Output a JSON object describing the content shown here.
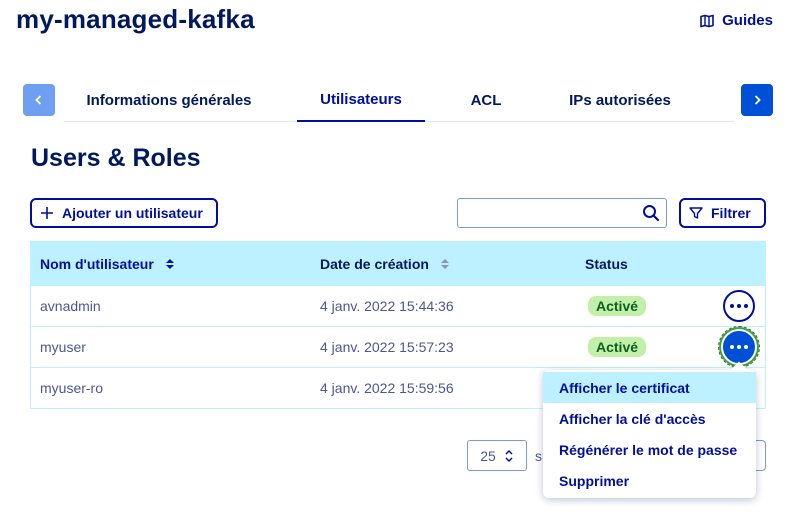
{
  "header": {
    "title": "my-managed-kafka",
    "guides_label": "Guides"
  },
  "tabs": [
    {
      "label": "Informations générales",
      "active": false
    },
    {
      "label": "Utilisateurs",
      "active": true
    },
    {
      "label": "ACL",
      "active": false
    },
    {
      "label": "IPs autorisées",
      "active": false
    }
  ],
  "section": {
    "title": "Users & Roles",
    "add_user_label": "Ajouter un utilisateur",
    "filter_label": "Filtrer",
    "search_value": ""
  },
  "table": {
    "headers": {
      "name": "Nom d'utilisateur",
      "date": "Date de création",
      "status": "Status"
    },
    "rows": [
      {
        "name": "avnadmin",
        "date": "4 janv. 2022 15:44:36",
        "status": "Activé"
      },
      {
        "name": "myuser",
        "date": "4 janv. 2022 15:57:23",
        "status": "Activé"
      },
      {
        "name": "myuser-ro",
        "date": "4 janv. 2022 15:59:56",
        "status": ""
      }
    ]
  },
  "pagination": {
    "page_size": "25",
    "suffix": "su"
  },
  "menu": {
    "items": [
      {
        "label": "Afficher le certificat",
        "active": true
      },
      {
        "label": "Afficher la clé d'accès",
        "active": false
      },
      {
        "label": "Régénérer le mot de passe",
        "active": false
      },
      {
        "label": "Supprimer",
        "active": false
      }
    ]
  },
  "colors": {
    "primary": "#000e9c",
    "title": "#00185e",
    "table_header_bg": "#bef1ff",
    "badge_bg": "#c2f0a8",
    "badge_text": "#0a5f22",
    "button_blue": "#0050d7"
  }
}
